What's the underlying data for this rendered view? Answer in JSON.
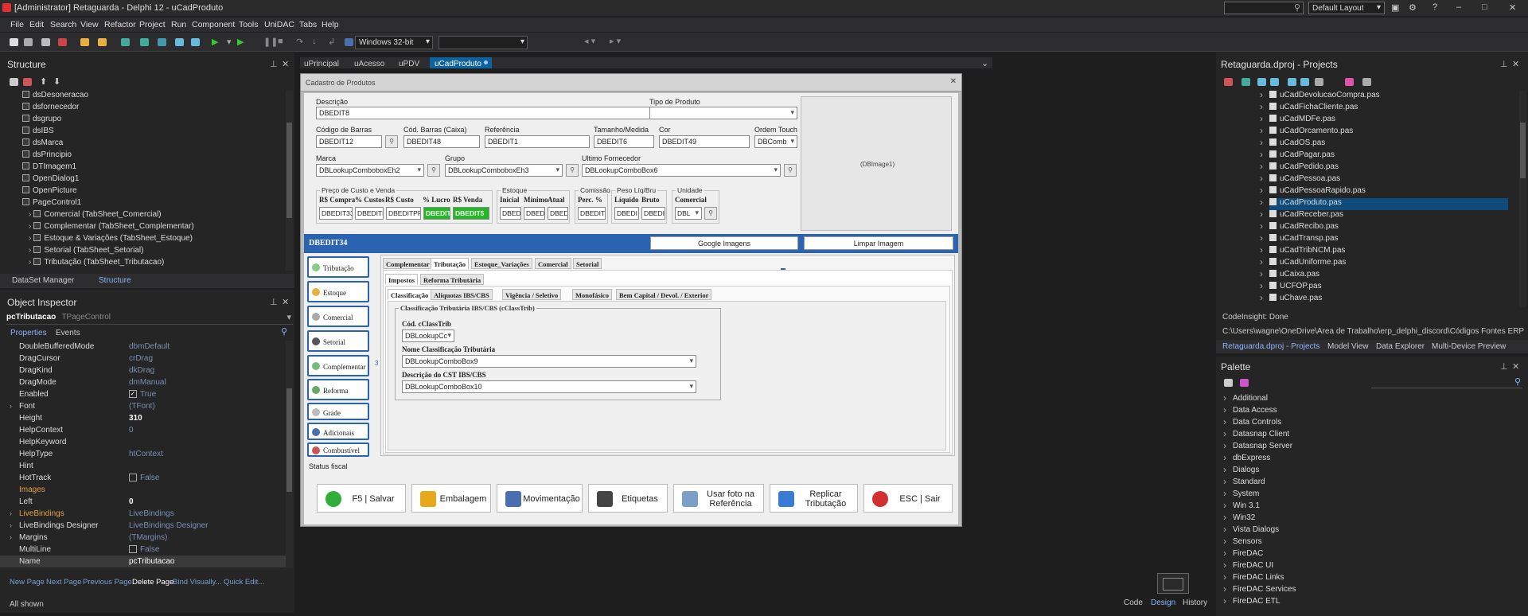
{
  "window": {
    "title": "[Administrator] Retaguarda - Delphi 12 - uCadProduto",
    "layout": "Default Layout",
    "min": "–",
    "max": "□",
    "close": "✕",
    "help": "?"
  },
  "menu": [
    "File",
    "Edit",
    "Search",
    "View",
    "Refactor",
    "Project",
    "Run",
    "Component",
    "Tools",
    "UniDAC",
    "Tabs",
    "Help"
  ],
  "toolbar": {
    "platform": "Windows 32-bit",
    "config": ""
  },
  "structure": {
    "title": "Structure",
    "items": [
      {
        "label": "dsDesoneracao",
        "indent": 1
      },
      {
        "label": "dsfornecedor",
        "indent": 1
      },
      {
        "label": "dsgrupo",
        "indent": 1
      },
      {
        "label": "dsIBS",
        "indent": 1
      },
      {
        "label": "dsMarca",
        "indent": 1
      },
      {
        "label": "dsPrincipio",
        "indent": 1
      },
      {
        "label": "DTImagem1",
        "indent": 1
      },
      {
        "label": "OpenDialog1",
        "indent": 1
      },
      {
        "label": "OpenPicture",
        "indent": 1
      },
      {
        "label": "PageControl1",
        "indent": 1
      },
      {
        "label": "Comercial (TabSheet_Comercial)",
        "indent": 2
      },
      {
        "label": "Complementar (TabSheet_Complementar)",
        "indent": 2
      },
      {
        "label": "Estoque & Variações (TabSheet_Estoque)",
        "indent": 2
      },
      {
        "label": "Setorial (TabSheet_Setorial)",
        "indent": 2
      },
      {
        "label": "Tributação (TabSheet_Tributacao)",
        "indent": 2
      }
    ],
    "tabs": [
      "DataSet Manager",
      "Structure"
    ]
  },
  "inspector": {
    "title": "Object Inspector",
    "object": "pcTributacao",
    "type": "TPageControl",
    "tabs": [
      "Properties",
      "Events"
    ],
    "rows": [
      {
        "k": "DoubleBufferedMode",
        "v": "dbmDefault"
      },
      {
        "k": "DragCursor",
        "v": "crDrag"
      },
      {
        "k": "DragKind",
        "v": "dkDrag"
      },
      {
        "k": "DragMode",
        "v": "dmManual"
      },
      {
        "k": "Enabled",
        "v": "True"
      },
      {
        "k": "Font",
        "v": "(TFont)"
      },
      {
        "k": "Height",
        "v": "310"
      },
      {
        "k": "HelpContext",
        "v": "0"
      },
      {
        "k": "HelpKeyword",
        "v": ""
      },
      {
        "k": "HelpType",
        "v": "htContext"
      },
      {
        "k": "Hint",
        "v": ""
      },
      {
        "k": "HotTrack",
        "v": "False"
      },
      {
        "k": "Images",
        "v": ""
      },
      {
        "k": "Left",
        "v": "0"
      },
      {
        "k": "LiveBindings",
        "v": "LiveBindings"
      },
      {
        "k": "LiveBindings Designer",
        "v": "LiveBindings Designer"
      },
      {
        "k": "Margins",
        "v": "(TMargins)"
      },
      {
        "k": "MultiLine",
        "v": "False"
      },
      {
        "k": "Name",
        "v": "pcTributacao"
      }
    ],
    "links": [
      "New Page",
      "Next Page",
      "Previous Page",
      "Delete Page",
      "Bind Visually...",
      "Quick Edit..."
    ],
    "status": "All shown"
  },
  "editor_tabs": [
    "uPrincipal",
    "uAcesso",
    "uPDV",
    "uCadProduto"
  ],
  "form": {
    "caption": "Cadastro de Produtos",
    "close": "✕",
    "descricao": {
      "label": "Descrição",
      "value": "DBEDIT8"
    },
    "tipo": {
      "label": "Tipo de Produto",
      "value": ""
    },
    "cod_barras": {
      "label": "Código de Barras",
      "value": "DBEDIT12"
    },
    "cod_barras_caixa": {
      "label": "Cód. Barras (Caixa)",
      "value": "DBEDIT48"
    },
    "referencia": {
      "label": "Referência",
      "value": "DBEDIT1"
    },
    "tamanho": {
      "label": "Tamanho/Medida",
      "value": "DBEDIT6"
    },
    "cor": {
      "label": "Cor",
      "value": "DBEDIT49"
    },
    "ordem_touch": {
      "label": "Ordem Touch",
      "value": "DBComb"
    },
    "marca": {
      "label": "Marca",
      "value": "DBLookupComboboxEh2"
    },
    "grupo": {
      "label": "Grupo",
      "value": "DBLookupComboboxEh3"
    },
    "fornecedor": {
      "label": "Ultimo Fornecedor",
      "value": "DBLookupComboBox6"
    },
    "image": "(DBImage1)",
    "preco": {
      "title": "Preço de Custo e Venda",
      "cols": [
        "R$ Compra",
        "% Custos",
        "R$ Custo",
        "% Lucro",
        "R$ Venda"
      ],
      "vals": [
        "DBEDIT33",
        "DBEDITP",
        "DBEDITPRE",
        "DBEDIT",
        "DBEDIT5"
      ]
    },
    "estoque": {
      "title": "Estoque",
      "cols": [
        "Inicial",
        "Mínimo",
        "Atual"
      ],
      "vals": [
        "DBEDI",
        "DBEDI",
        "DBEDI"
      ]
    },
    "comissao": {
      "title": "Comissão",
      "cols": [
        "Perc. %"
      ],
      "vals": [
        "DBEDIT"
      ]
    },
    "peso": {
      "title": "Peso Líq/Bru",
      "cols": [
        "Líquido",
        "Bruto"
      ],
      "vals": [
        "DBEDI",
        "DBEDI"
      ]
    },
    "unidade": {
      "title": "Unidade",
      "cols": [
        "Comercial"
      ],
      "vals": [
        "DBL"
      ]
    },
    "banner": "DBEDIT34",
    "google_btn": "Google Imagens",
    "limpar_btn": "Limpar Imagem",
    "nav": [
      "Tributação",
      "Estoque",
      "Comercial",
      "Setorial",
      "Complementar",
      "Reforma",
      "Grade",
      "Adicionais",
      "Combustível"
    ],
    "tabs1": [
      "Complementar",
      "Tributação",
      "Estoque_Variações",
      "Comercial",
      "Setorial"
    ],
    "tabs2": [
      "Impostos",
      "Reforma Tributária"
    ],
    "tabs3": [
      "Classificação",
      "Alíquotas IBS/CBS",
      "Vigência / Seletivo",
      "Monofásico",
      "Bem Capital / Devol. / Exterior"
    ],
    "class_group": "Classificação Tributária IBS/CBS (cClassTrib)",
    "cclass": {
      "label": "Cód. cClassTrib",
      "value": "DBLookupCc"
    },
    "nome_class": {
      "label": "Nome Classificação Tributária",
      "value": "DBLookupComboBox9"
    },
    "cst": {
      "label": "Descrição do CST IBS/CBS",
      "value": "DBLookupComboBox10"
    },
    "page_marker": "3",
    "status": "Status fiscal",
    "actions": [
      {
        "label": "F5 | Salvar",
        "color": "#2fae3a"
      },
      {
        "label": "Embalagem",
        "color": "#e8a81e"
      },
      {
        "label": "Movimentação",
        "color": "#4a6fb0"
      },
      {
        "label": "Etiquetas",
        "color": "#444444"
      },
      {
        "label": "Usar foto na Referência",
        "color": "#7aa0c8"
      },
      {
        "label": "Replicar Tributação",
        "color": "#3a7bd5"
      },
      {
        "label": "ESC | Sair",
        "color": "#d23030"
      }
    ]
  },
  "projects": {
    "title": "Retaguarda.dproj - Projects",
    "items": [
      "uCadDevolucaoCompra.pas",
      "uCadFichaCliente.pas",
      "uCadMDFe.pas",
      "uCadOrcamento.pas",
      "uCadOS.pas",
      "uCadPagar.pas",
      "uCadPedido.pas",
      "uCadPessoa.pas",
      "uCadPessoaRapido.pas",
      "uCadProduto.pas",
      "uCadReceber.pas",
      "uCadRecibo.pas",
      "uCadTransp.pas",
      "uCadTribNCM.pas",
      "uCadUniforme.pas",
      "uCaixa.pas",
      "UCFOP.pas",
      "uChave.pas"
    ],
    "selected": "uCadProduto.pas",
    "codeinsight": "CodeInsight: Done",
    "path": "C:\\Users\\wagne\\OneDrive\\Área de Trabalho\\erp_delphi_discord\\Códigos Fontes ERP ...",
    "tabs": [
      "Retaguarda.dproj - Projects",
      "Model View",
      "Data Explorer",
      "Multi-Device Preview"
    ]
  },
  "palette": {
    "title": "Palette",
    "items": [
      "Additional",
      "Data Access",
      "Data Controls",
      "Datasnap Client",
      "Datasnap Server",
      "dbExpress",
      "Dialogs",
      "Standard",
      "System",
      "Win 3.1",
      "Win32",
      "Vista Dialogs",
      "Sensors",
      "FireDAC",
      "FireDAC UI",
      "FireDAC Links",
      "FireDAC Services",
      "FireDAC ETL"
    ]
  },
  "bottom": {
    "tabs": [
      "Code",
      "Design",
      "History"
    ]
  }
}
